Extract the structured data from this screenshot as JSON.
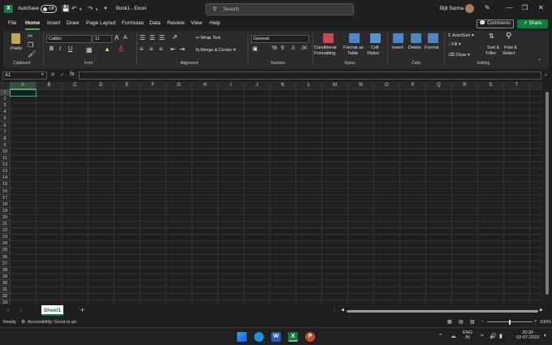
{
  "titlebar": {
    "autosave_label": "AutoSave",
    "autosave_state": "Off",
    "doc_title": "Book1  -  Excel",
    "search_placeholder": "Search",
    "user_name": "Bijit Sarma"
  },
  "menu": {
    "tabs": [
      "File",
      "Home",
      "Insert",
      "Draw",
      "Page Layout",
      "Formulas",
      "Data",
      "Review",
      "View",
      "Help"
    ],
    "active": "Home",
    "comments_label": "Comments",
    "share_label": "Share"
  },
  "ribbon": {
    "clipboard": {
      "paste": "Paste",
      "group": "Clipboard"
    },
    "font": {
      "name": "Calibri",
      "size": "11",
      "group": "Font"
    },
    "alignment": {
      "wrap_text": "Wrap Text",
      "merge_center": "Merge & Center",
      "group": "Alignment"
    },
    "number": {
      "format": "General",
      "group": "Number"
    },
    "styles": {
      "conditional": "Conditional",
      "conditional2": "Formatting",
      "format_as": "Format as",
      "format_as2": "Table",
      "cell": "Cell",
      "cell2": "Styles",
      "group": "Styles"
    },
    "cells": {
      "insert": "Insert",
      "delete": "Delete",
      "format": "Format",
      "group": "Cells"
    },
    "editing": {
      "autosum": "AutoSum",
      "fill": "Fill",
      "clear": "Clear",
      "sort": "Sort &",
      "sort2": "Filter",
      "find": "Find &",
      "find2": "Select",
      "group": "Editing"
    }
  },
  "formula": {
    "name_box": "A1",
    "fx": "fx",
    "value": ""
  },
  "grid": {
    "columns": [
      "A",
      "B",
      "C",
      "D",
      "E",
      "F",
      "G",
      "H",
      "I",
      "J",
      "K",
      "L",
      "M",
      "N",
      "O",
      "P",
      "Q",
      "R",
      "S",
      "T"
    ],
    "rows": [
      "1",
      "2",
      "3",
      "4",
      "5",
      "6",
      "7",
      "8",
      "9",
      "10",
      "11",
      "12",
      "13",
      "14",
      "15",
      "16",
      "17",
      "18",
      "19",
      "20",
      "21",
      "22",
      "23",
      "24",
      "25",
      "26",
      "27",
      "28",
      "29",
      "30",
      "31",
      "32",
      "33"
    ],
    "active_cell": "A1"
  },
  "sheets": {
    "tabs": [
      "Sheet1"
    ],
    "add": "+"
  },
  "status": {
    "mode": "Ready",
    "accessibility": "Accessibility: Good to go",
    "zoom": "100%"
  },
  "taskbar": {
    "lang": "ENG",
    "lang2": "IN",
    "time": "20:34",
    "date": "03-07-2023"
  }
}
